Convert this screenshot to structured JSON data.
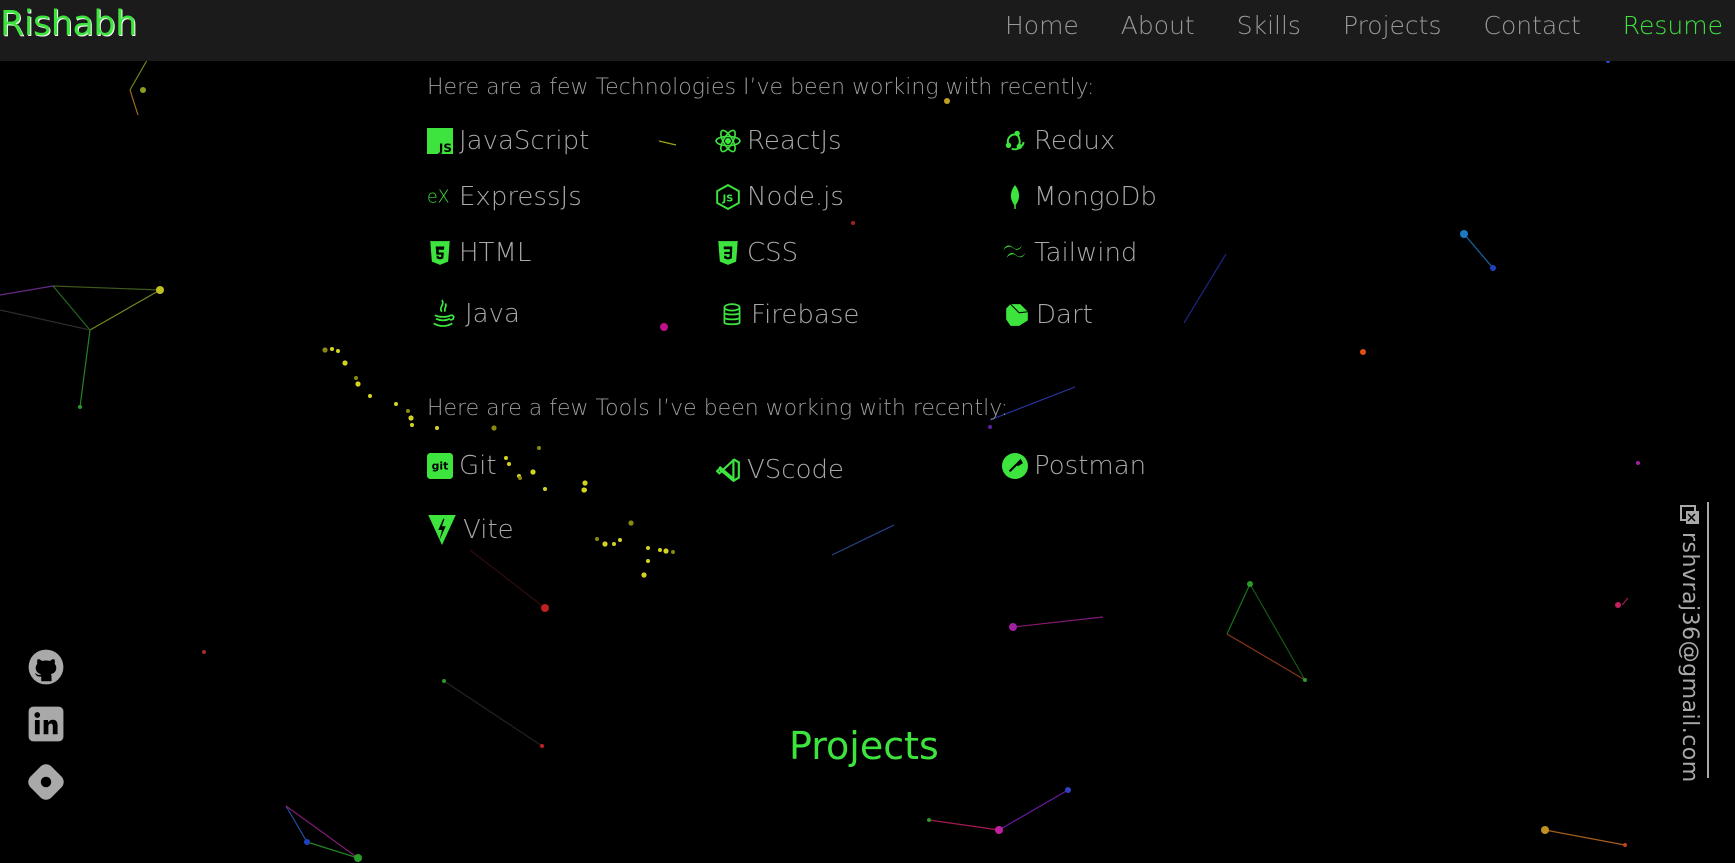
{
  "brand": "Rishabh",
  "nav": {
    "items": [
      "Home",
      "About",
      "Skills",
      "Projects",
      "Contact"
    ],
    "resume": "Resume"
  },
  "technologies": {
    "intro": "Here are a few Technologies I’ve been working with recently:",
    "items": [
      "JavaScript",
      "ReactJs",
      "Redux",
      "ExpressJs",
      "Node.js",
      "MongoDb",
      "HTML",
      "CSS",
      "Tailwind",
      "Java",
      "Firebase",
      "Dart"
    ]
  },
  "tools": {
    "intro": "Here are a few Tools I’ve been working with recently:",
    "items": [
      "Git",
      "VScode",
      "Postman",
      "Vite"
    ]
  },
  "projects_title": "Projects",
  "email": "rshvraj36@gmail.com",
  "colors": {
    "accent": "#3ee43e",
    "text": "#a9a9a9",
    "header_bg": "#1b1b1b",
    "page_bg": "#000000"
  },
  "icons": {
    "social": [
      "github-icon",
      "linkedin-icon",
      "codepen-icon"
    ],
    "email": "email-icon"
  }
}
